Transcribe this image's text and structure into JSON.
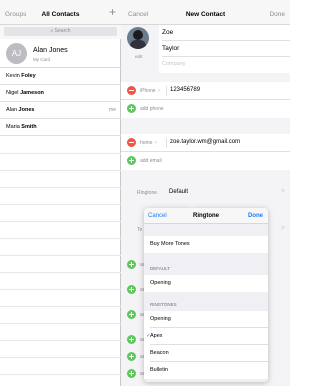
{
  "left_pane": {
    "groups_label": "Groups",
    "title": "All Contacts",
    "add_symbol": "+",
    "search_placeholder": "Search",
    "my_card": {
      "initials": "AJ",
      "name": "Alan Jones",
      "subtitle": "My Card"
    },
    "contacts": [
      {
        "first": "Kevin ",
        "last": "Foley",
        "badge": ""
      },
      {
        "first": "Nigel ",
        "last": "Jameson",
        "badge": ""
      },
      {
        "first": "Alan ",
        "last": "Jones",
        "badge": "me"
      },
      {
        "first": "Maria ",
        "last": "Smith",
        "badge": ""
      }
    ]
  },
  "right_pane": {
    "cancel_label": "Cancel",
    "title": "New Contact",
    "done_label": "Done",
    "photo_edit_label": "edit",
    "first_name": "Zoe",
    "last_name": "Taylor",
    "company_placeholder": "Company",
    "phone": {
      "label": "iPhone",
      "chevron": ">",
      "value": "123456789"
    },
    "add_phone_label": "add phone",
    "email": {
      "label": "home",
      "chevron": ">",
      "value": "zoe.taylor.wm@gmail.com"
    },
    "add_email_label": "add email",
    "ringtone": {
      "label": "Ringtone",
      "value": "Default",
      "chevron": ">"
    },
    "background_rows": [
      {
        "label": "Te",
        "chevron": ">"
      },
      {
        "label": "ad"
      },
      {
        "label": "ad"
      },
      {
        "label": "ad"
      },
      {
        "label": "ad"
      },
      {
        "label": "ad"
      },
      {
        "label": "ad"
      }
    ]
  },
  "ringtone_popover": {
    "cancel_label": "Cancel",
    "title": "Ringtone",
    "done_label": "Done",
    "buy_more_tones": "Buy More Tones",
    "default_header": "DEFAULT",
    "default_item": "Opening",
    "ringtones_header": "RINGTONES",
    "ringtones": [
      "Opening",
      "Apex",
      "Beacon",
      "Bulletin"
    ],
    "selected_check": "✓",
    "selected_index": 1
  },
  "colors": {
    "accent": "#1b7cf5",
    "delete_red": "#f0554b",
    "add_green": "#5cc85c",
    "secondary_text": "#8e8e93"
  }
}
